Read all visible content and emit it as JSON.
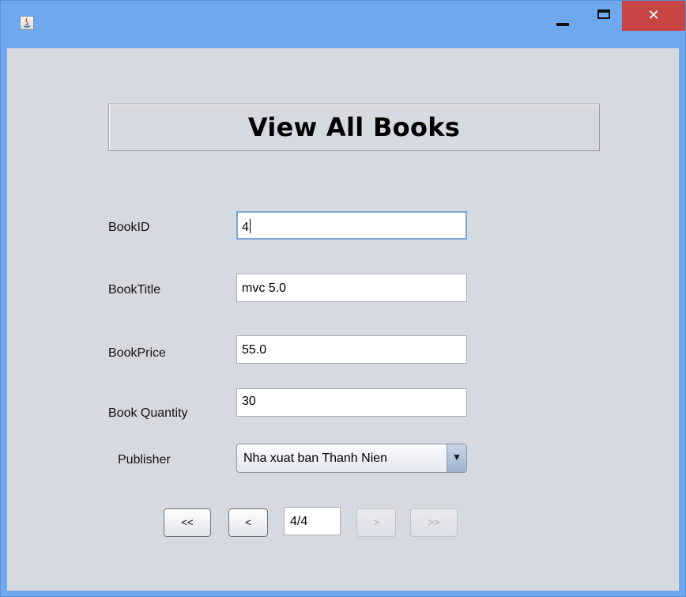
{
  "window": {
    "close_symbol": "✕"
  },
  "heading": "View All Books",
  "form": {
    "book_id": {
      "label": "BookID",
      "value": "4"
    },
    "book_title": {
      "label": "BookTitle",
      "value": "mvc 5.0"
    },
    "book_price": {
      "label": "BookPrice",
      "value": "55.0"
    },
    "book_quantity": {
      "label": "Book Quantity",
      "value": "30"
    },
    "publisher": {
      "label": "Publisher",
      "selected": "Nha xuat ban Thanh Nien",
      "arrow": "▼"
    }
  },
  "navigation": {
    "first_label": "<<",
    "prev_label": "<",
    "page_value": "4/4",
    "next_label": ">",
    "last_label": ">>"
  },
  "colors": {
    "titlebar": "#6ea8ef",
    "close": "#c74545",
    "panel": "#d6d9e0"
  }
}
